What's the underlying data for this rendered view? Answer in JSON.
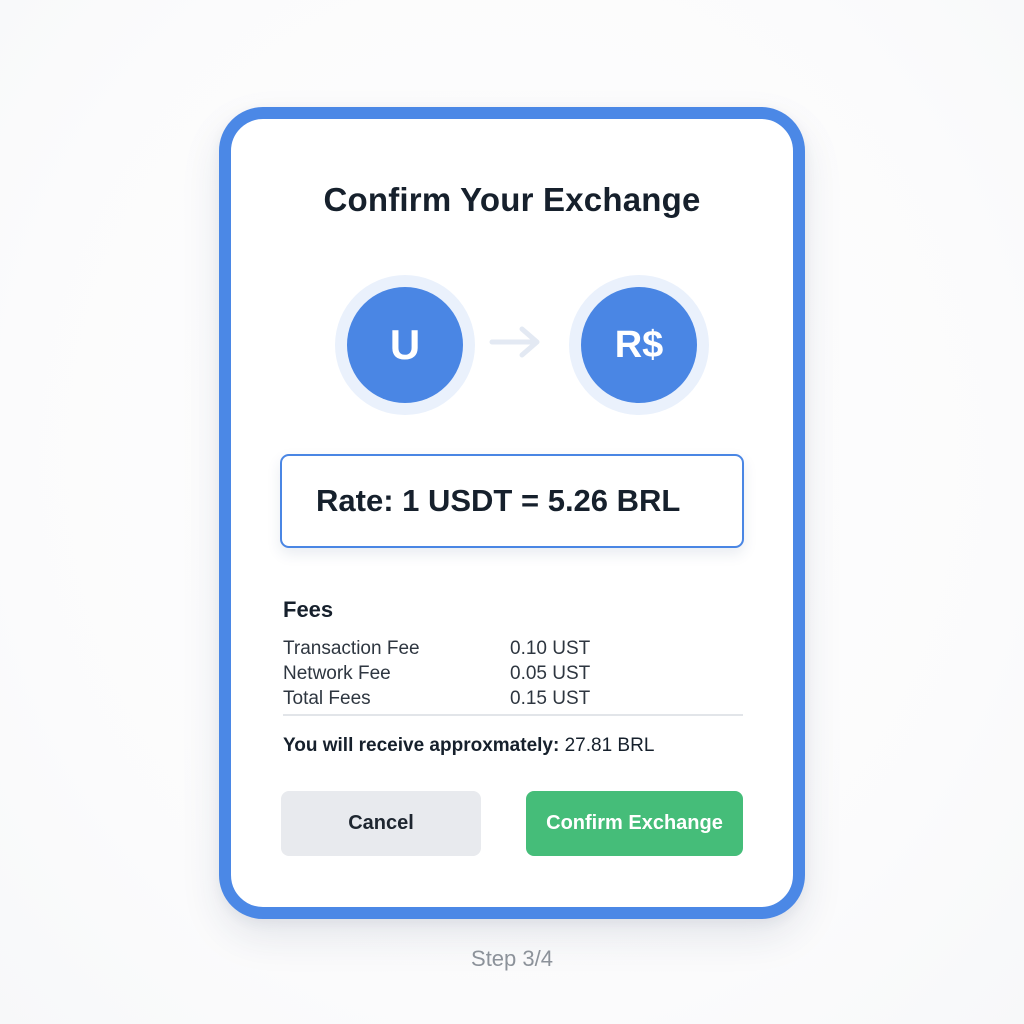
{
  "modal": {
    "title": "Confirm Your Exchange",
    "from_currency": {
      "symbol": "U"
    },
    "to_currency": {
      "symbol": "R$"
    },
    "rate_text": "Rate: 1 USDT = 5.26 BRL",
    "fees": {
      "heading": "Fees",
      "rows": [
        {
          "label": "Transaction Fee",
          "value": "0.10 UST"
        },
        {
          "label": "Network Fee",
          "value": "0.05 UST"
        },
        {
          "label": "Total Fees",
          "value": "0.15 UST"
        }
      ]
    },
    "receive": {
      "label": "You will receive approxmately:",
      "amount": "27.81 BRL"
    },
    "buttons": {
      "cancel": "Cancel",
      "confirm": "Confirm Exchange"
    }
  },
  "step_indicator": "Step 3/4",
  "colors": {
    "accent_blue": "#4b88e6",
    "confirm_green": "#45bd79",
    "cancel_gray": "#e8eaee"
  },
  "icons": {
    "arrow": "arrow-right-icon"
  }
}
